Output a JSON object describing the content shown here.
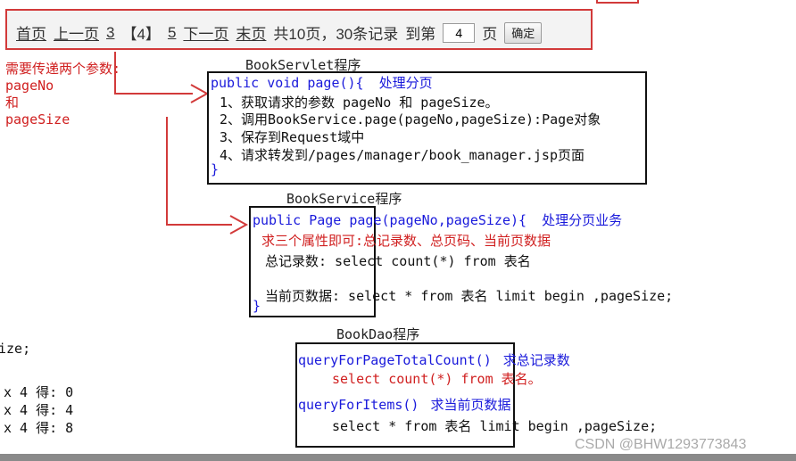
{
  "pager": {
    "first": "首页",
    "prev": "上一页",
    "page3": "3",
    "current": "【4】",
    "page5": "5",
    "next": "下一页",
    "last": "末页",
    "summary": "共10页，30条记录",
    "goto": "到第",
    "input_value": "4",
    "page_word": "页",
    "confirm": "确定"
  },
  "note": {
    "lines": [
      "需要传递两个参数:",
      "pageNo",
      "和",
      "pageSize"
    ]
  },
  "servlet": {
    "title": "BookServlet程序",
    "signature": "public void page(){",
    "comment": "处理分页",
    "steps": [
      "1、获取请求的参数 pageNo 和 pageSize。",
      "2、调用BookService.page(pageNo,pageSize):Page对象",
      "3、保存到Request域中",
      "4、请求转发到/pages/manager/book_manager.jsp页面"
    ],
    "close": "}"
  },
  "service": {
    "title": "BookService程序",
    "signature": "public Page page(pageNo,pageSize){",
    "comment": "处理分页业务",
    "hint": "求三个属性即可:总记录数、总页码、当前页数据",
    "count_line": "总记录数:  select count(*) from 表名",
    "data_line": "当前页数据: select * from 表名 limit begin ,pageSize;",
    "close": "}"
  },
  "dao": {
    "title": "BookDao程序",
    "method1": "queryForPageTotalCount()",
    "method1_comment": "求总记录数",
    "method1_sql": "select count(*) from 表名。",
    "method2": "queryForItems()",
    "method2_comment": "求当前页数据",
    "method2_sql": "select * from 表名 limit begin ,pageSize;"
  },
  "left_fragments": {
    "size": "ize;",
    "r1": "x 4 得: 0",
    "r2": "x 4 得: 4",
    "r3": "x 4 得: 8"
  },
  "watermark": "CSDN @BHW1293773843",
  "colors": {
    "red": "#d02020",
    "blue": "#1a1adb",
    "border": "#111111"
  }
}
